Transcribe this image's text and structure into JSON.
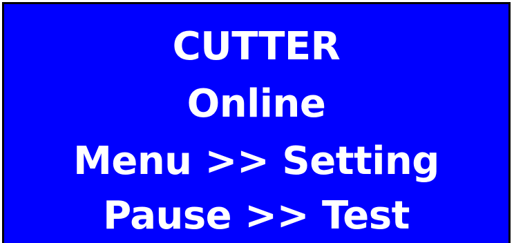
{
  "display": {
    "background_color": "#0000ff",
    "text_color": "#ffffff",
    "lines": [
      "CUTTER",
      "Online",
      "Menu >> Setting",
      "Pause >> Test"
    ]
  }
}
